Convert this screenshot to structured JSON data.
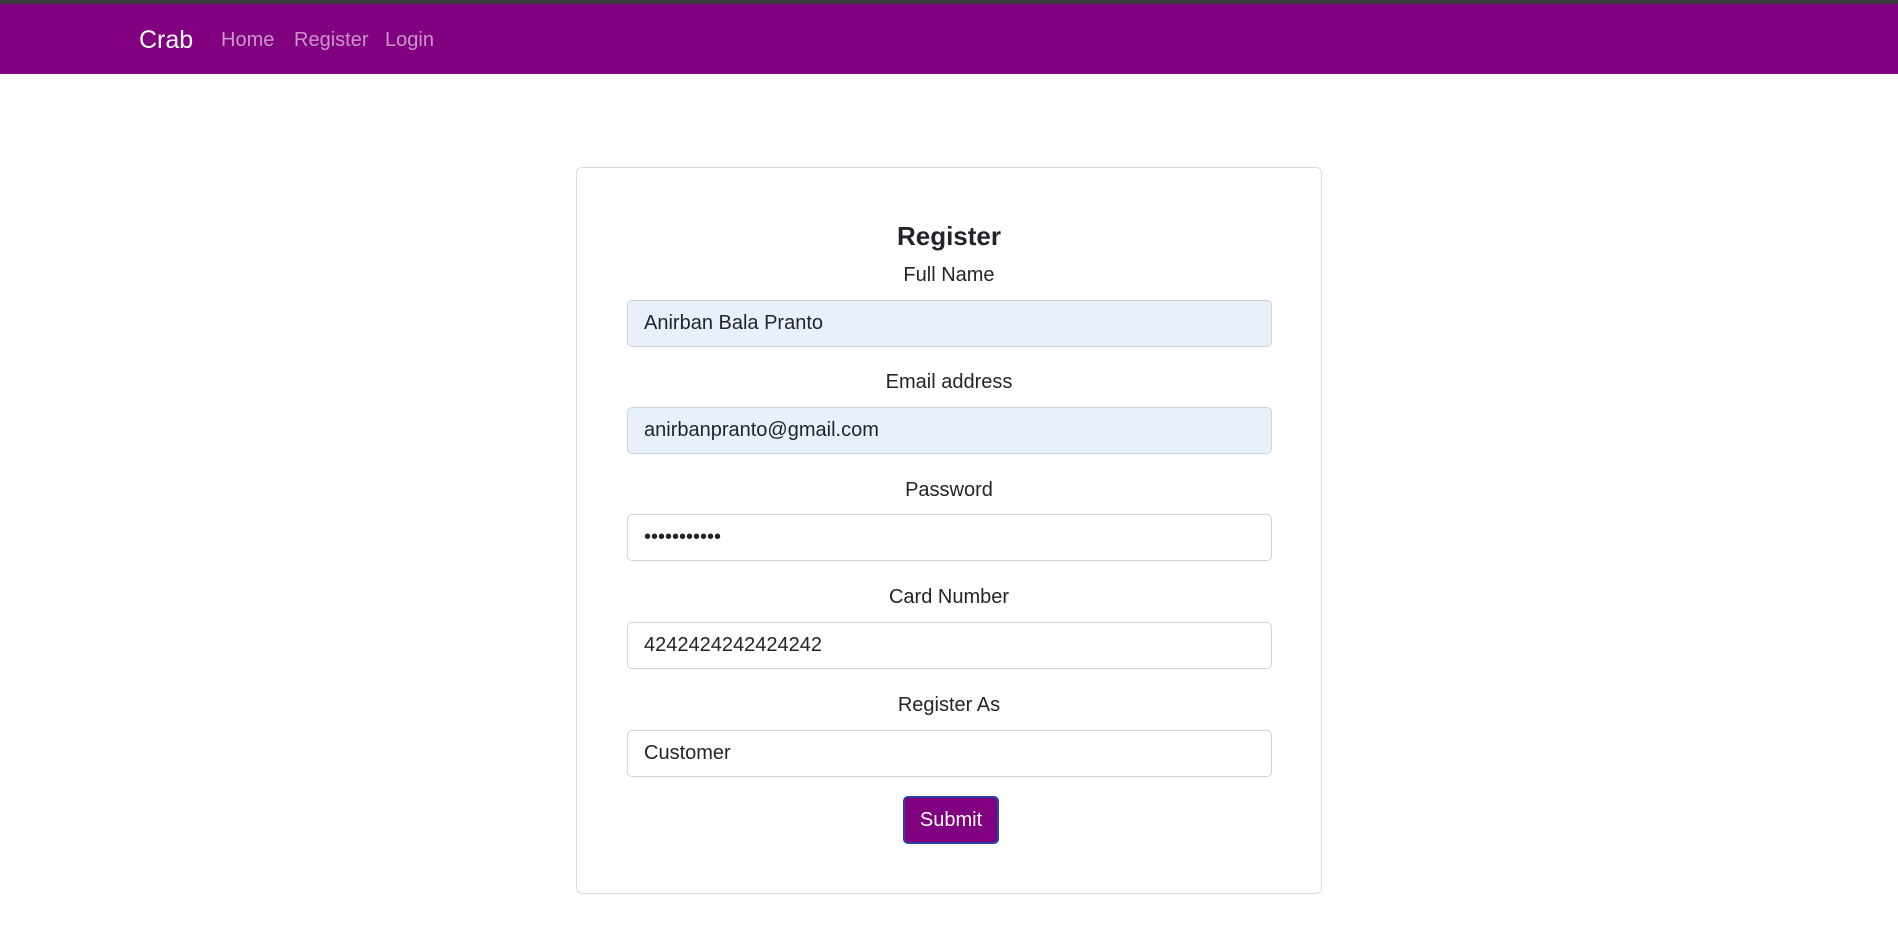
{
  "nav": {
    "brand": "Crab",
    "links": [
      "Home",
      "Register",
      "Login"
    ]
  },
  "form": {
    "title": "Register",
    "fields": [
      {
        "label": "Full Name",
        "value": "Anirban Bala Pranto"
      },
      {
        "label": "Email address",
        "value": "anirbanpranto@gmail.com"
      },
      {
        "label": "Password",
        "value": "•••••••••••"
      },
      {
        "label": "Card Number",
        "value": "4242424242424242"
      },
      {
        "label": "Register As",
        "value": "Customer"
      }
    ],
    "submit_label": "Submit"
  },
  "colors": {
    "navbar": "#800080",
    "button": "#800080",
    "autofill": "#e8f0fe"
  }
}
